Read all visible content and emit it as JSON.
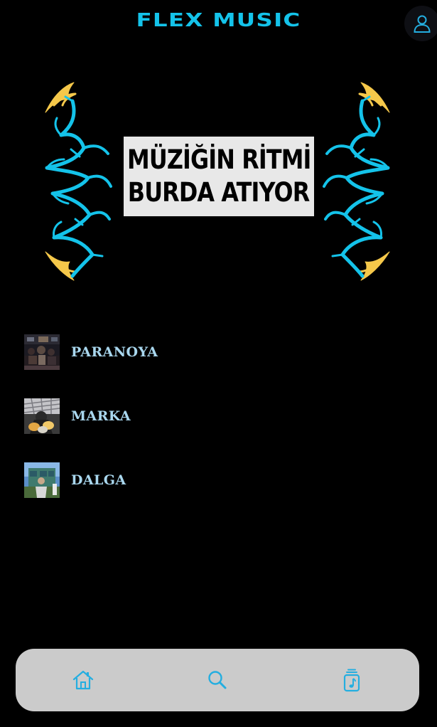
{
  "header": {
    "app_name": "FLEX MUSIC",
    "profile_icon": "user-icon"
  },
  "banner": {
    "line1": "MÜZİĞİN RİTMİ",
    "line2": "BURDA ATIYOR",
    "accent_color": "#14c3ea",
    "secondary_color": "#f5c84a"
  },
  "tracks": [
    {
      "title": "PARANOYA"
    },
    {
      "title": "MARKA"
    },
    {
      "title": "DALGA"
    }
  ],
  "bottom_nav": {
    "items": [
      {
        "icon": "home-icon"
      },
      {
        "icon": "search-icon"
      },
      {
        "icon": "music-library-icon"
      }
    ],
    "icon_color": "#24aee0"
  },
  "colors": {
    "logo": "#14c3ea",
    "track_title": "#a9d7ee",
    "nav_background": "#cbcbcb"
  }
}
